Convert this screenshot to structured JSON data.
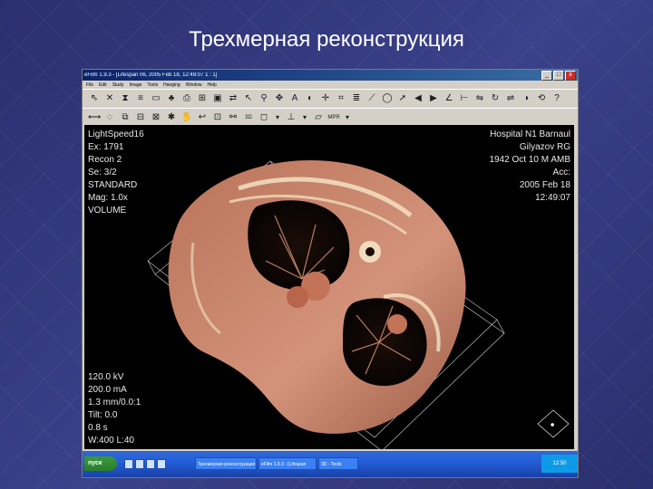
{
  "slide": {
    "title": "Трехмерная реконструкция"
  },
  "window": {
    "title": "eFilm 1.9.3 - [Lifespan 06, 2005 Feb 18, 12:49:07 1 : 1]",
    "min_glyph": "_",
    "max_glyph": "□",
    "close_glyph": "x"
  },
  "menubar": [
    "File",
    "Edit",
    "Study",
    "Image",
    "Tools",
    "Hanging",
    "Window",
    "Help"
  ],
  "toolbar1": [
    {
      "icon": "pointer-icon",
      "glyph": "⇖"
    },
    {
      "icon": "close-x-icon",
      "glyph": "✕"
    },
    {
      "icon": "hourglass-icon",
      "glyph": "⧗"
    },
    {
      "icon": "list-icon",
      "glyph": "≡"
    },
    {
      "icon": "folder-icon",
      "glyph": "▭"
    },
    {
      "icon": "network-icon",
      "glyph": "♣"
    },
    {
      "icon": "print-icon",
      "glyph": "⎙"
    },
    {
      "icon": "layout-icon",
      "glyph": "⊞"
    },
    {
      "icon": "monitor-icon",
      "glyph": "▣"
    },
    {
      "icon": "cine-icon",
      "glyph": "⇄"
    },
    {
      "icon": "cursor-icon",
      "glyph": "↖"
    },
    {
      "icon": "zoom-icon",
      "glyph": "⚲"
    },
    {
      "icon": "pan-icon",
      "glyph": "✥"
    },
    {
      "icon": "text-icon",
      "glyph": "A"
    },
    {
      "icon": "window-level-icon",
      "glyph": "◐"
    },
    {
      "icon": "crosshair-icon",
      "glyph": "✛"
    },
    {
      "icon": "grid-icon",
      "glyph": "⌗"
    },
    {
      "icon": "layers-icon",
      "glyph": "≣"
    },
    {
      "icon": "measure-icon",
      "glyph": "⟋"
    },
    {
      "icon": "roi-icon",
      "glyph": "◯"
    },
    {
      "icon": "arrow-icon",
      "glyph": "➚"
    },
    {
      "icon": "prev-icon",
      "glyph": "◀"
    },
    {
      "icon": "next-icon",
      "glyph": "▶"
    },
    {
      "icon": "angle-icon",
      "glyph": "∠"
    },
    {
      "icon": "ruler-icon",
      "glyph": "⊢"
    },
    {
      "icon": "flip-icon",
      "glyph": "⇋"
    },
    {
      "icon": "rotate-icon",
      "glyph": "↻"
    },
    {
      "icon": "mirror-icon",
      "glyph": "⇌"
    },
    {
      "icon": "invert-icon",
      "glyph": "◑"
    },
    {
      "icon": "reset-icon",
      "glyph": "⟲"
    },
    {
      "icon": "help-icon",
      "glyph": "?"
    }
  ],
  "toolbar2": [
    {
      "icon": "ruler-tool-icon",
      "glyph": "⟷"
    },
    {
      "icon": "ellipse-tool-icon",
      "glyph": "◌"
    },
    {
      "icon": "stack-icon",
      "glyph": "⧉"
    },
    {
      "icon": "series-icon",
      "glyph": "⊟"
    },
    {
      "icon": "mpr-icon",
      "glyph": "⊠"
    },
    {
      "icon": "mip-icon",
      "glyph": "✱"
    },
    {
      "icon": "hand-icon",
      "glyph": "✋"
    },
    {
      "icon": "undo-icon",
      "glyph": "↩"
    },
    {
      "icon": "compare-icon",
      "glyph": "⊡"
    },
    {
      "icon": "link-icon",
      "glyph": "⚯"
    },
    {
      "icon": "3d-icon",
      "glyph": "3D"
    },
    {
      "icon": "box-icon",
      "glyph": "◻"
    },
    {
      "icon": "dropdown-icon",
      "glyph": "▾"
    },
    {
      "icon": "plane-icon",
      "glyph": "⊥"
    },
    {
      "icon": "dropdown-icon",
      "glyph": "▾"
    },
    {
      "icon": "slab-icon",
      "glyph": "▱"
    },
    {
      "icon": "mpr-text-icon",
      "glyph": "MPR"
    },
    {
      "icon": "dropdown-icon",
      "glyph": "▾"
    }
  ],
  "overlay": {
    "top_left": [
      "LightSpeed16",
      "Ex: 1791",
      "Recon 2",
      "Se: 3/2",
      "STANDARD",
      "Mag: 1.0x",
      "VOLUME"
    ],
    "top_right": [
      "Hospital N1 Barnaul",
      "Gilyazov RG",
      "1942 Oct 10 M AMB",
      "Acc:",
      "2005 Feb 18",
      "12:49:07"
    ],
    "bottom_left": [
      "120.0 kV",
      "200.0 mA",
      "1.3 mm/0.0:1",
      "Tilt: 0.0",
      "0.8 s",
      "W:400 L:40"
    ]
  },
  "taskbar": {
    "start_label": "пуск",
    "items": [
      "Трехмерная реконструкция",
      "eFilm 1.9.3 - [Lifespan",
      "3D - Tools"
    ],
    "clock": "12:50"
  },
  "colors": {
    "slide_bg": "#2f3580",
    "window_chrome": "#d4d0c8",
    "titlebar": "#0a246a",
    "viewport": "#000000",
    "tissue": "#c07a5a",
    "bone": "#f0e0c0"
  }
}
